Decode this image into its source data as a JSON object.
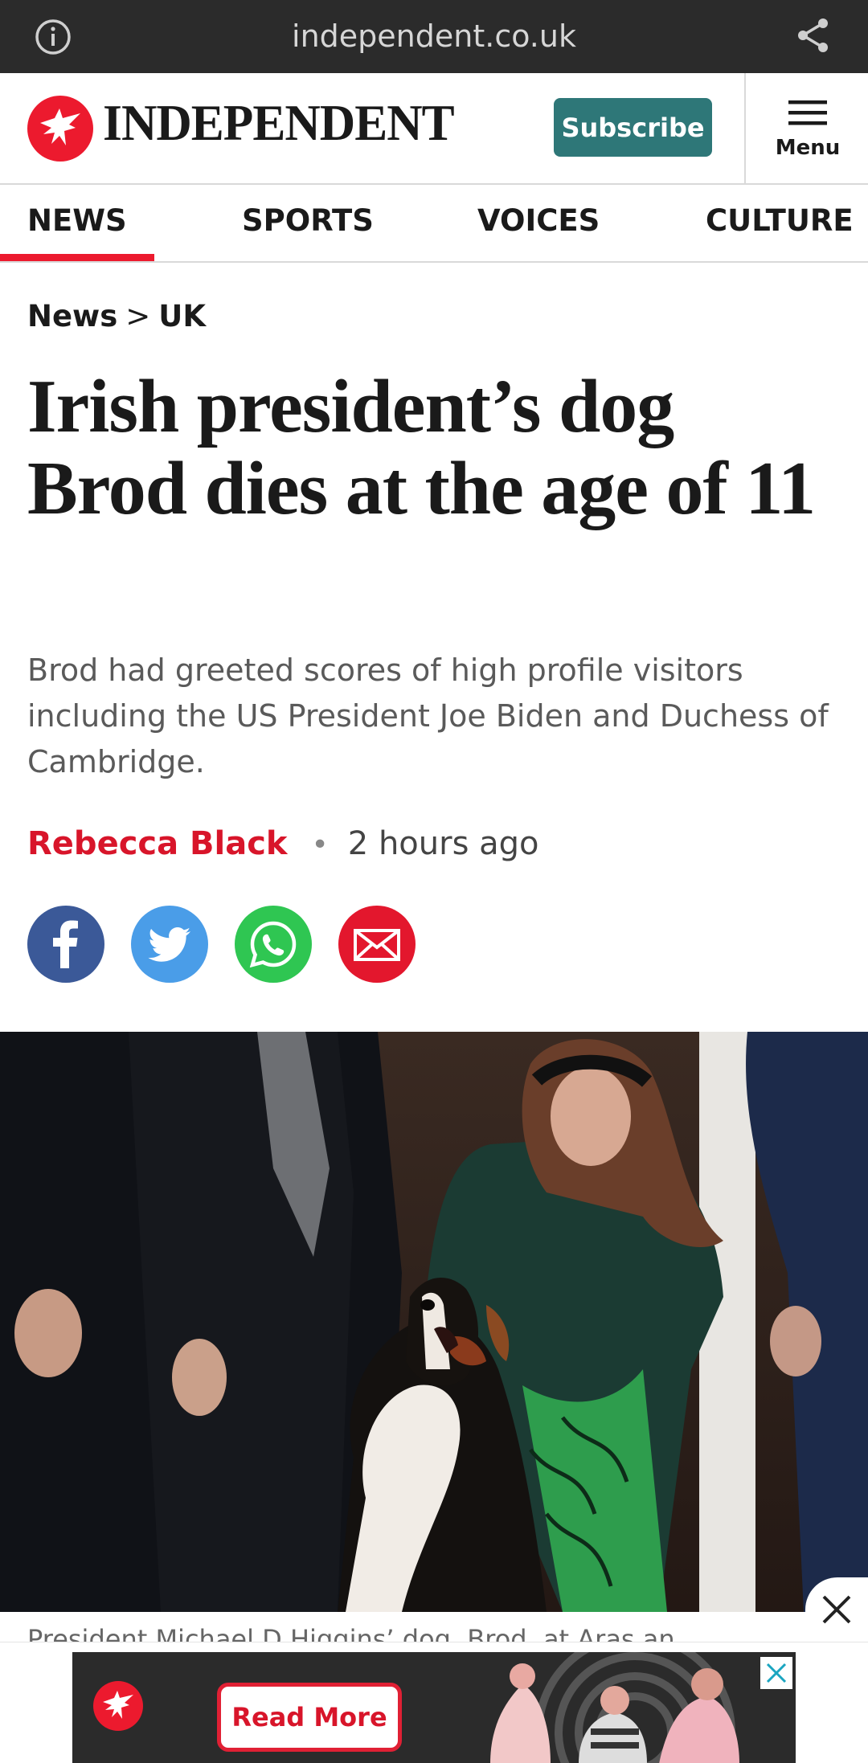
{
  "browser": {
    "url": "independent.co.uk"
  },
  "header": {
    "logo_text": "INDEPENDENT",
    "subscribe_label": "Subscribe",
    "menu_label": "Menu"
  },
  "nav": {
    "tabs": [
      {
        "label": "NEWS",
        "active": true
      },
      {
        "label": "SPORTS",
        "active": false
      },
      {
        "label": "VOICES",
        "active": false
      },
      {
        "label": "CULTURE",
        "active": false
      }
    ]
  },
  "breadcrumb": {
    "section": "News",
    "separator": ">",
    "subsection": "UK"
  },
  "article": {
    "headline": "Irish president’s dog Brod dies at the age of 11",
    "standfirst": "Brod had greeted scores of high profile visitors including the US President Joe Biden and Duchess of Cambridge.",
    "author": "Rebecca Black",
    "time_ago": "2 hours ago",
    "caption": "President Michael D Higgins’ dog, Brod, at Aras an"
  },
  "share": {
    "icons": [
      "facebook-icon",
      "twitter-icon",
      "whatsapp-icon",
      "email-icon"
    ]
  },
  "ad": {
    "cta_label": "Read More"
  },
  "colors": {
    "brand_red": "#ec1a2e",
    "subscribe_teal": "#2e7778",
    "facebook": "#3b5998",
    "twitter": "#4a9de8",
    "whatsapp": "#2fc652",
    "email": "#e3172d"
  }
}
